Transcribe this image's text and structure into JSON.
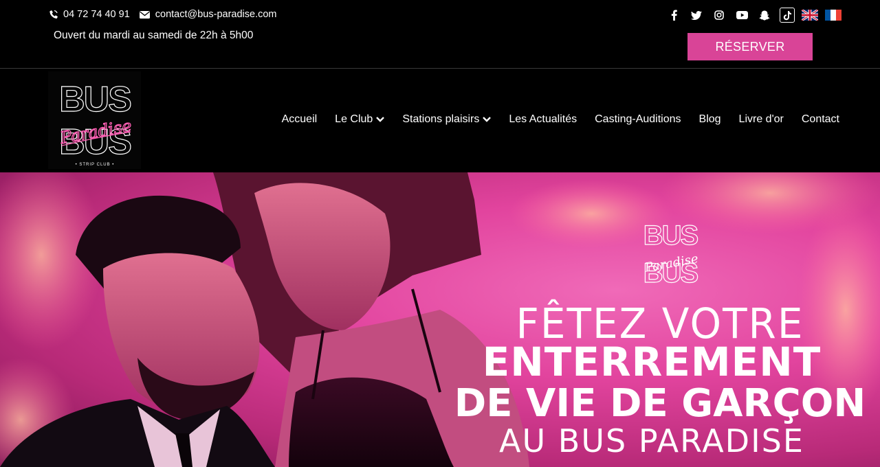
{
  "topbar": {
    "phone": "04 72 74 40 91",
    "email": "contact@bus-paradise.com",
    "hours": "Ouvert du mardi au samedi de 22h à 5h00",
    "reserve_label": "RÉSERVER",
    "social_icons": [
      "facebook-icon",
      "twitter-icon",
      "instagram-icon",
      "youtube-icon",
      "snapchat-icon",
      "tiktok-icon"
    ],
    "flags": [
      "uk-flag-icon",
      "france-flag-icon"
    ]
  },
  "logo": {
    "word_top": "BUS",
    "script": "Paradise",
    "tagline": "STRIP CLUB"
  },
  "nav": {
    "items": [
      {
        "label": "Accueil",
        "dropdown": false
      },
      {
        "label": "Le Club",
        "dropdown": true
      },
      {
        "label": "Stations plaisirs",
        "dropdown": true
      },
      {
        "label": "Les Actualités",
        "dropdown": false
      },
      {
        "label": "Casting-Auditions",
        "dropdown": false
      },
      {
        "label": "Blog",
        "dropdown": false
      },
      {
        "label": "Livre d'or",
        "dropdown": false
      },
      {
        "label": "Contact",
        "dropdown": false
      }
    ]
  },
  "hero": {
    "line1": "FÊTEZ VOTRE",
    "line2": "ENTERREMENT",
    "line3": "DE VIE DE GARÇON",
    "line4": "AU BUS PARADISE",
    "logo_word": "BUS",
    "logo_script": "Paradise"
  },
  "colors": {
    "accent": "#d94497",
    "hero_pink": "#e2449e",
    "background": "#000000"
  }
}
